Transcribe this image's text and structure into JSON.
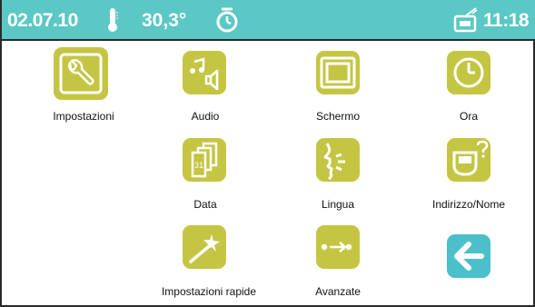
{
  "status_bar": {
    "date": "02.07.10",
    "thermometer_icon": "thermometer-icon",
    "temperature": "30,3°",
    "timer_icon": "alarm-timer-icon",
    "radio_icon": "radio-icon",
    "time": "11:18",
    "color": "#5bc8c5"
  },
  "menu": {
    "tile_color": "#c5c544",
    "back_color": "#4bbfca",
    "items": [
      {
        "id": "impostazioni",
        "label": "Impostazioni",
        "icon": "wrench-icon"
      },
      {
        "id": "audio",
        "label": "Audio",
        "icon": "audio-note-speaker-icon"
      },
      {
        "id": "schermo",
        "label": "Schermo",
        "icon": "screen-icon"
      },
      {
        "id": "ora",
        "label": "Ora",
        "icon": "clock-icon"
      },
      {
        "id": "data",
        "label": "Data",
        "icon": "calendar-icon"
      },
      {
        "id": "lingua",
        "label": "Lingua",
        "icon": "speaking-face-icon"
      },
      {
        "id": "indirizzo",
        "label": "Indirizzo/Nome",
        "icon": "address-question-icon"
      },
      {
        "id": "rapide",
        "label": "Impostazioni rapide",
        "icon": "magic-wand-icon"
      },
      {
        "id": "avanzate",
        "label": "Avanzate",
        "icon": "advanced-arrow-icon"
      },
      {
        "id": "back",
        "label": "",
        "icon": "back-arrow-icon"
      }
    ],
    "calendar_day": "31"
  }
}
